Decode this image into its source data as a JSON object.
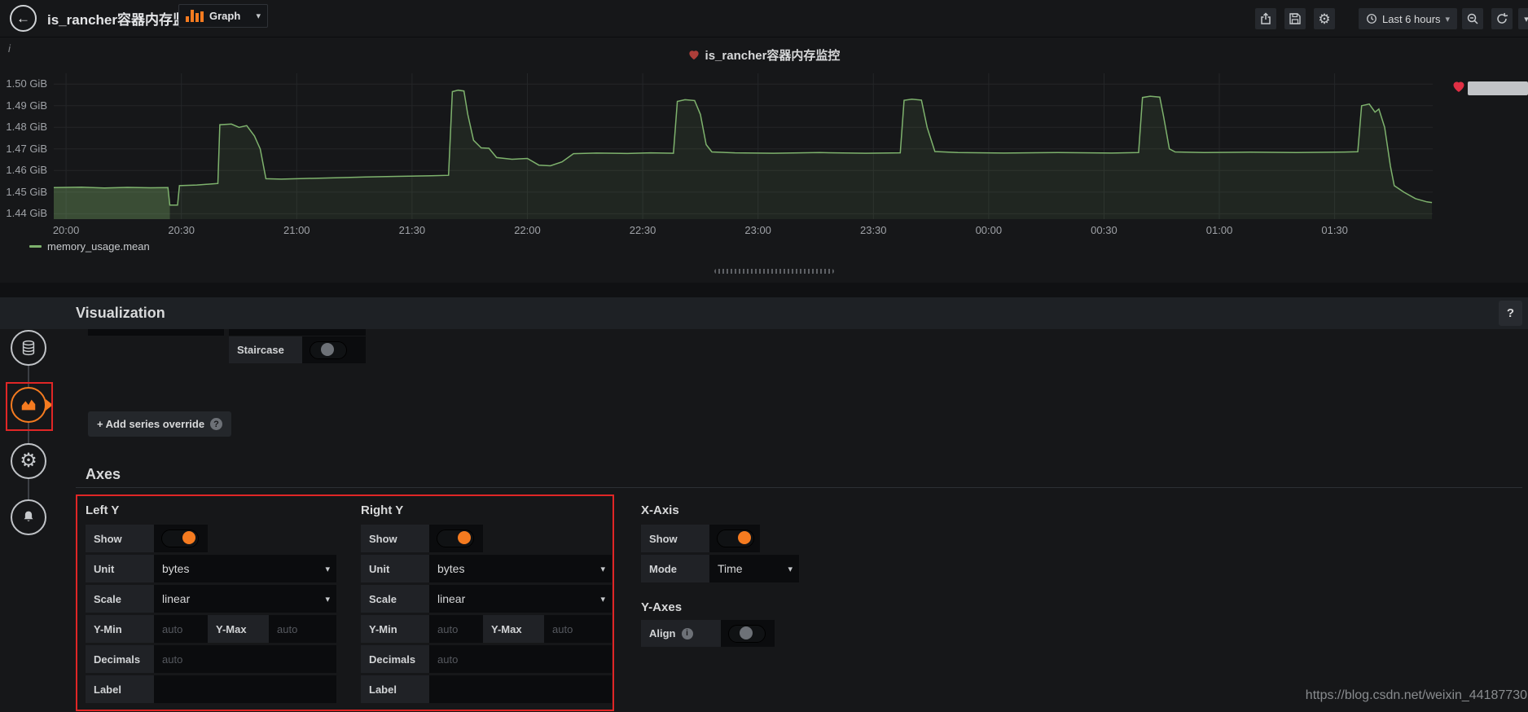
{
  "colors": {
    "accent_orange": "#f57b20",
    "series_green": "#7eb26d",
    "alert_red": "#e02f44",
    "annotation_red": "#e02626"
  },
  "navbar": {
    "title": "is_rancher容器内存监控",
    "time_picker": "Last 6 hours"
  },
  "panel": {
    "title": "is_rancher容器内存监控",
    "info_indicator": "i"
  },
  "chart_data": {
    "type": "line",
    "title": "is_rancher容器内存监控",
    "xlabel": "",
    "ylabel": "",
    "unit": "GiB",
    "grid": true,
    "legend_position": "bottom-left",
    "xlim": [
      -3.2,
      355.5
    ],
    "ylim": [
      1.4375,
      1.505
    ],
    "x_ticks": [
      {
        "t": 0,
        "label": "20:00"
      },
      {
        "t": 30,
        "label": "20:30"
      },
      {
        "t": 60,
        "label": "21:00"
      },
      {
        "t": 90,
        "label": "21:30"
      },
      {
        "t": 120,
        "label": "22:00"
      },
      {
        "t": 150,
        "label": "22:30"
      },
      {
        "t": 180,
        "label": "23:00"
      },
      {
        "t": 210,
        "label": "23:30"
      },
      {
        "t": 240,
        "label": "00:00"
      },
      {
        "t": 270,
        "label": "00:30"
      },
      {
        "t": 300,
        "label": "01:00"
      },
      {
        "t": 330,
        "label": "01:30"
      }
    ],
    "y_ticks": [
      {
        "value": 1.44,
        "label": "1.44 GiB"
      },
      {
        "value": 1.45,
        "label": "1.45 GiB"
      },
      {
        "value": 1.46,
        "label": "1.46 GiB"
      },
      {
        "value": 1.47,
        "label": "1.47 GiB"
      },
      {
        "value": 1.48,
        "label": "1.48 GiB"
      },
      {
        "value": 1.49,
        "label": "1.49 GiB"
      },
      {
        "value": 1.5,
        "label": "1.50 GiB"
      }
    ],
    "series": [
      {
        "name": "memory_usage.mean",
        "color": "#7eb26d",
        "points": [
          [
            -3.2,
            1.4521
          ],
          [
            4,
            1.4523
          ],
          [
            10,
            1.4519
          ],
          [
            16,
            1.4522
          ],
          [
            22,
            1.452
          ],
          [
            26.5,
            1.4521
          ],
          [
            27,
            1.444
          ],
          [
            29,
            1.444
          ],
          [
            29.5,
            1.453
          ],
          [
            34,
            1.4533
          ],
          [
            38,
            1.4538
          ],
          [
            39.5,
            1.454
          ],
          [
            40,
            1.4812
          ],
          [
            43,
            1.4815
          ],
          [
            45,
            1.48
          ],
          [
            47,
            1.4808
          ],
          [
            49,
            1.476
          ],
          [
            50.5,
            1.47
          ],
          [
            52,
            1.4562
          ],
          [
            56,
            1.456
          ],
          [
            62,
            1.4563
          ],
          [
            70,
            1.4566
          ],
          [
            78,
            1.457
          ],
          [
            86,
            1.4573
          ],
          [
            95,
            1.4576
          ],
          [
            99.5,
            1.4578
          ],
          [
            100.5,
            1.4965
          ],
          [
            102,
            1.4972
          ],
          [
            103.5,
            1.4968
          ],
          [
            104.5,
            1.486
          ],
          [
            106,
            1.474
          ],
          [
            108,
            1.4705
          ],
          [
            110,
            1.4703
          ],
          [
            112,
            1.466
          ],
          [
            116,
            1.4652
          ],
          [
            120,
            1.4656
          ],
          [
            123,
            1.4625
          ],
          [
            126,
            1.4622
          ],
          [
            129,
            1.464
          ],
          [
            132,
            1.4678
          ],
          [
            138,
            1.4681
          ],
          [
            146,
            1.4679
          ],
          [
            152,
            1.4682
          ],
          [
            158,
            1.468
          ],
          [
            159,
            1.492
          ],
          [
            161,
            1.4928
          ],
          [
            163.5,
            1.4924
          ],
          [
            165,
            1.486
          ],
          [
            166.5,
            1.472
          ],
          [
            168,
            1.4686
          ],
          [
            174,
            1.4682
          ],
          [
            184,
            1.468
          ],
          [
            196,
            1.4683
          ],
          [
            208,
            1.468
          ],
          [
            217,
            1.4682
          ],
          [
            218,
            1.4925
          ],
          [
            220,
            1.493
          ],
          [
            222.5,
            1.4926
          ],
          [
            224,
            1.48
          ],
          [
            226,
            1.4688
          ],
          [
            232,
            1.4683
          ],
          [
            244,
            1.4681
          ],
          [
            258,
            1.4683
          ],
          [
            272,
            1.4681
          ],
          [
            279,
            1.4683
          ],
          [
            280,
            1.4938
          ],
          [
            282,
            1.4944
          ],
          [
            284.5,
            1.494
          ],
          [
            285.5,
            1.485
          ],
          [
            287,
            1.47
          ],
          [
            288.5,
            1.4686
          ],
          [
            296,
            1.4683
          ],
          [
            308,
            1.4685
          ],
          [
            320,
            1.4683
          ],
          [
            330,
            1.4685
          ],
          [
            336,
            1.4687
          ],
          [
            337,
            1.49
          ],
          [
            339,
            1.4908
          ],
          [
            340.5,
            1.487
          ],
          [
            341.5,
            1.4885
          ],
          [
            343,
            1.48
          ],
          [
            344.5,
            1.462
          ],
          [
            345.5,
            1.453
          ],
          [
            348,
            1.45
          ],
          [
            351,
            1.447
          ],
          [
            354,
            1.4455
          ],
          [
            355.3,
            1.4452
          ]
        ]
      }
    ]
  },
  "editor": {
    "header": "Visualization",
    "type_label": "Graph",
    "help_label": "?"
  },
  "display_options": {
    "staircase_label": "Staircase",
    "add_series_override_label": "+ Add series override",
    "override_help": "?"
  },
  "axes": {
    "header": "Axes",
    "left_y": {
      "title": "Left Y",
      "show_label": "Show",
      "unit_label": "Unit",
      "unit_value": "bytes",
      "scale_label": "Scale",
      "scale_value": "linear",
      "y_min_label": "Y-Min",
      "y_min_placeholder": "auto",
      "y_max_label": "Y-Max",
      "y_max_placeholder": "auto",
      "decimals_label": "Decimals",
      "decimals_placeholder": "auto",
      "label_label": "Label",
      "label_value": ""
    },
    "right_y": {
      "title": "Right Y",
      "show_label": "Show",
      "unit_label": "Unit",
      "unit_value": "bytes",
      "scale_label": "Scale",
      "scale_value": "linear",
      "y_min_label": "Y-Min",
      "y_min_placeholder": "auto",
      "y_max_label": "Y-Max",
      "y_max_placeholder": "auto",
      "decimals_label": "Decimals",
      "decimals_placeholder": "auto",
      "label_label": "Label",
      "label_value": ""
    },
    "x_axis": {
      "title": "X-Axis",
      "show_label": "Show",
      "mode_label": "Mode",
      "mode_value": "Time"
    },
    "y_axes": {
      "title": "Y-Axes",
      "align_label": "Align"
    }
  },
  "watermark": "https://blog.csdn.net/weixin_44187730"
}
